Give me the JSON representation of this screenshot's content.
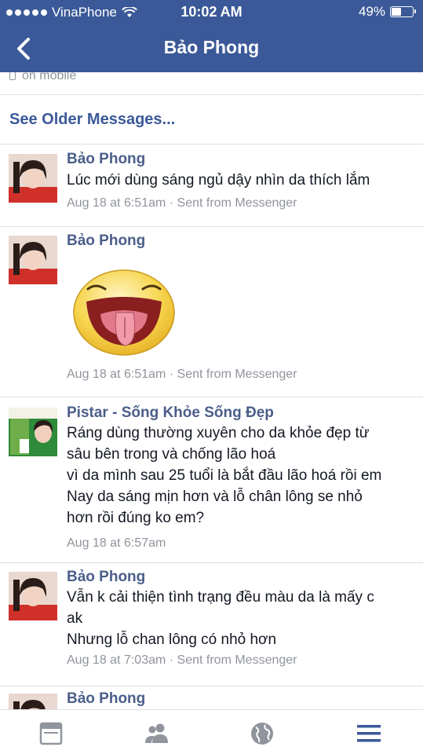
{
  "status_bar": {
    "carrier": "VinaPhone",
    "time": "10:02 AM",
    "battery": "49%",
    "battery_level": 0.49
  },
  "nav": {
    "title": "Bảo Phong",
    "back_icon": "chevron-left-icon"
  },
  "thread": {
    "on_mobile": "on mobile",
    "see_older": "See Older Messages..."
  },
  "messages": [
    {
      "sender": "Bảo Phong",
      "lines": [
        "Lúc mới dùng sáng ngủ dậy nhìn da thích lắm"
      ],
      "meta": "Aug 18 at 6:51am · Sent from Messenger"
    },
    {
      "sender": "Bảo Phong",
      "sticker": "tongue-out-emoji-sticker",
      "meta": "Aug 18 at 6:51am · Sent from Messenger"
    },
    {
      "sender": "Pistar - Sống Khỏe Sống Đẹp",
      "lines": [
        "Ráng dùng thường xuyên cho da khỏe đẹp từ",
        "sâu bên trong và chống lão hoá",
        "vì da mình sau 25 tuổi là bắt đầu lão hoá rồi em",
        "Nay da sáng mịn hơn và lỗ chân lông se nhỏ",
        "hơn rồi đúng ko em?"
      ],
      "meta": "Aug 18 at 6:57am"
    },
    {
      "sender": "Bảo Phong",
      "lines": [
        "Vẫn k cải thiện tình trạng đều màu da là mấy c",
        "ak",
        "Nhưng lỗ chan lông có nhỏ hơn"
      ],
      "meta": "Aug 18 at 7:03am · Sent from Messenger"
    },
    {
      "sender": "Bảo Phong"
    }
  ],
  "tab_bar": {
    "icons": [
      "news-feed-icon",
      "friends-icon",
      "globe-icon",
      "menu-icon"
    ],
    "active_color": "#3b5998",
    "inactive_color": "#90949c"
  },
  "colors": {
    "header_bg": "#3b5998",
    "link": "#3b5998",
    "sender": "#4b5e8a",
    "meta": "#90949c"
  }
}
